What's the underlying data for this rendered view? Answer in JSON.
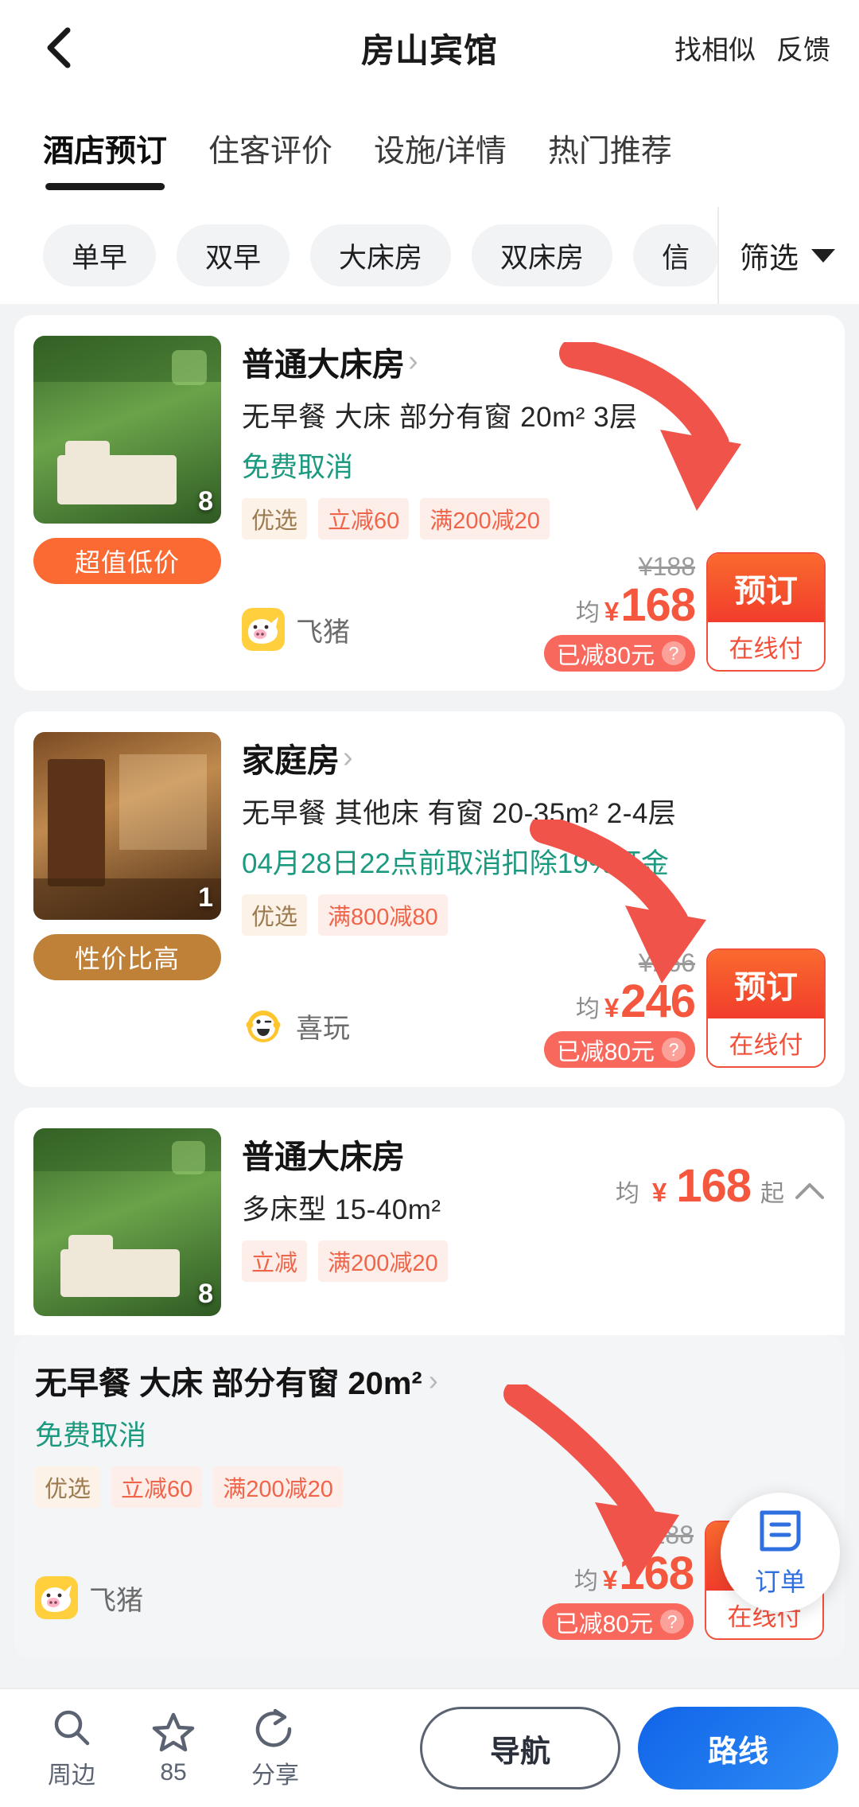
{
  "header": {
    "back_icon": "chevron-left-icon",
    "title": "房山宾馆",
    "actions": [
      {
        "label": "找相似",
        "name": "find-similar"
      },
      {
        "label": "反馈",
        "name": "feedback"
      }
    ]
  },
  "tabs": [
    {
      "label": "酒店预订",
      "active": true
    },
    {
      "label": "住客评价",
      "active": false
    },
    {
      "label": "设施/详情",
      "active": false
    },
    {
      "label": "热门推荐",
      "active": false
    }
  ],
  "filters": {
    "chips": [
      "单早",
      "双早",
      "大床房",
      "双床房",
      "信"
    ],
    "filter_label": "筛选",
    "caret_icon": "caret-down-icon"
  },
  "rooms": [
    {
      "name": "普通大床房",
      "chev": "›",
      "meta": "无早餐  大床  部分有窗  20m²  3层",
      "cancel": "免费取消",
      "tags": [
        {
          "text": "优选",
          "kind": "pref"
        },
        {
          "text": "立减60",
          "kind": "promo"
        },
        {
          "text": "满200减20",
          "kind": "promo"
        }
      ],
      "ribbon": "超值低价",
      "photo_count": "8",
      "merchant": "飞猪",
      "merchant_icon": "fliggy-pig-icon",
      "orig_price": "¥188",
      "avg_label": "均",
      "yen": "¥",
      "price": "168",
      "saved": "已减80元",
      "saved_help_icon": "question-mark-icon",
      "book_label": "预订",
      "pay_label": "在线付"
    },
    {
      "name": "家庭房",
      "chev": "›",
      "meta": "无早餐  其他床  有窗  20-35m²  2-4层",
      "cancel": "04月28日22点前取消扣除19%订金",
      "tags": [
        {
          "text": "优选",
          "kind": "pref"
        },
        {
          "text": "满800减80",
          "kind": "promo"
        }
      ],
      "ribbon": "性价比高",
      "photo_count": "1",
      "merchant": "喜玩",
      "merchant_icon": "xiwan-face-icon",
      "orig_price": "¥266",
      "avg_label": "均",
      "yen": "¥",
      "price": "246",
      "saved": "已减80元",
      "saved_help_icon": "question-mark-icon",
      "book_label": "预订",
      "pay_label": "在线付"
    }
  ],
  "collapsed_room": {
    "name": "普通大床房",
    "meta": "多床型  15-40m²",
    "tags": [
      {
        "text": "立减",
        "kind": "promo"
      },
      {
        "text": "满200减20",
        "kind": "promo"
      }
    ],
    "photo_count": "8",
    "avg_label": "均",
    "yen": "¥",
    "price": "168",
    "from_label": "起",
    "collapse_icon": "chevron-up-icon"
  },
  "sub_row": {
    "title": "无早餐 大床 部分有窗 20m²",
    "chev": "›",
    "cancel": "免费取消",
    "tags": [
      {
        "text": "优选",
        "kind": "pref"
      },
      {
        "text": "立减60",
        "kind": "promo"
      },
      {
        "text": "满200减20",
        "kind": "promo"
      }
    ],
    "merchant": "飞猪",
    "merchant_icon": "fliggy-pig-icon",
    "orig_price": "¥188",
    "avg_label": "均",
    "yen": "¥",
    "price": "168",
    "saved": "已减80元",
    "book_label": "预订",
    "pay_label": "在线付"
  },
  "fab": {
    "label": "订单",
    "icon": "order-document-icon"
  },
  "bottom_bar": {
    "items": [
      {
        "label": "周边",
        "icon": "search-icon"
      },
      {
        "label": "85",
        "icon": "star-icon"
      },
      {
        "label": "分享",
        "icon": "share-icon"
      }
    ],
    "nav_button": "导航",
    "route_button": "路线"
  },
  "colors": {
    "accent_red": "#f4573e",
    "book_gradient_start": "#fa6a2e",
    "book_gradient_end": "#f13d2c",
    "teal": "#1c9a80",
    "brand_blue": "#2f8cf5",
    "annotation_red": "#f0534a"
  }
}
